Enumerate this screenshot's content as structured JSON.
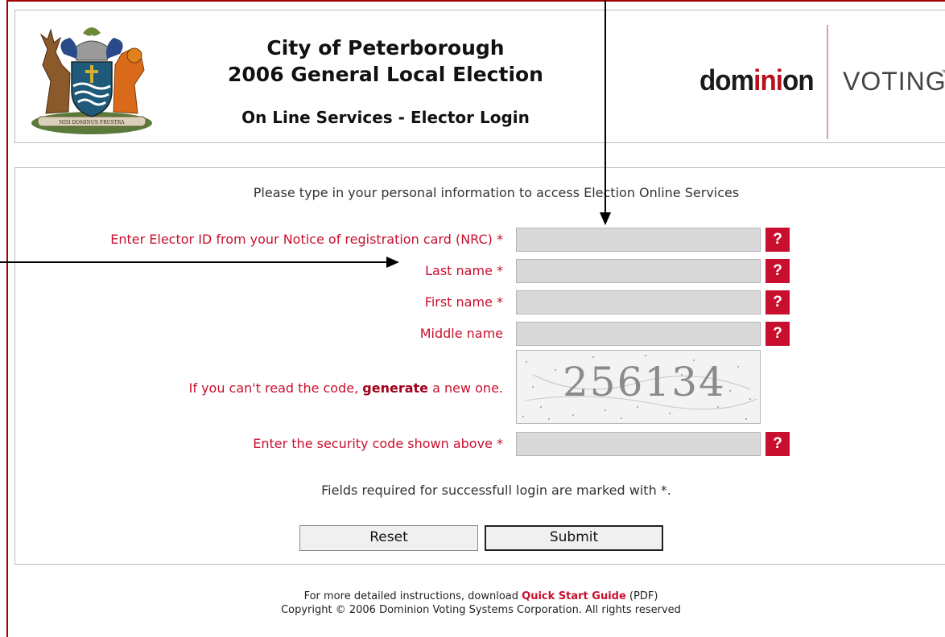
{
  "header": {
    "title_line1": "City of Peterborough",
    "title_line2": "2006 General Local Election",
    "subtitle": "On Line Services - Elector Login",
    "crest_motto": "NISI DOMINUS FRUSTRA",
    "logo": {
      "word_prefix": "dom",
      "word_accent": "ini",
      "word_suffix": "on",
      "voting": "VOTING",
      "tm": "™"
    }
  },
  "form": {
    "instructions": "Please type in your personal information to access Election Online Services",
    "fields": {
      "elector_id": {
        "label": "Enter Elector ID from your Notice of registration card (NRC) *",
        "value": "",
        "placeholder": ""
      },
      "last_name": {
        "label": "Last name *",
        "value": "",
        "placeholder": ""
      },
      "first_name": {
        "label": "First name *",
        "value": "",
        "placeholder": ""
      },
      "middle_name": {
        "label": "Middle name",
        "value": "",
        "placeholder": ""
      },
      "security_code": {
        "label": "Enter the security code shown above *",
        "value": "",
        "placeholder": ""
      }
    },
    "help_glyph": "?",
    "captcha": {
      "prefix": "If you can't read the code, ",
      "link": "generate",
      "suffix": " a new one.",
      "code": "256134"
    },
    "required_note": "Fields required for successfull login are marked with *.",
    "reset_label": "Reset",
    "submit_label": "Submit"
  },
  "footer": {
    "line1_prefix": "For more detailed instructions, download ",
    "line1_link": "Quick Start Guide",
    "line1_suffix": " (PDF)",
    "copyright": "Copyright © 2006 Dominion Voting Systems Corporation. All rights reserved"
  },
  "colors": {
    "accent_red": "#c8102e",
    "frame_red": "#a00000",
    "input_gray": "#d9d9d9"
  }
}
